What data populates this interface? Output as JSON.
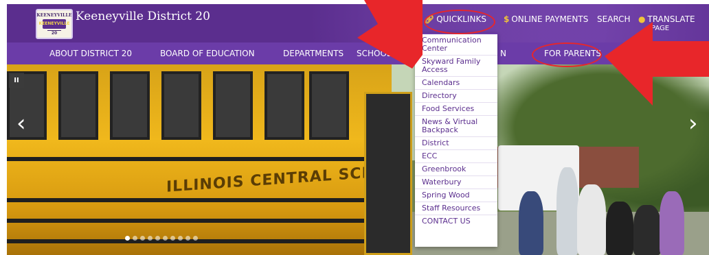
{
  "header": {
    "logo": {
      "top_text": "KEENEYVILLE",
      "badge_text": "KEENEYVILLE",
      "number": "20"
    },
    "site_title": "Keeneyville District 20",
    "utility_nav": {
      "quicklinks": "QUICKLINKS",
      "online_payments": "ONLINE PAYMENTS",
      "search": "SEARCH",
      "translate": "TRANSLATE",
      "translate_sub": "PAGE"
    }
  },
  "main_nav": {
    "items": [
      "ABOUT DISTRICT 20",
      "BOARD OF EDUCATION",
      "DEPARTMENTS",
      "SCHOOLS",
      "N",
      "FOR PARENTS"
    ]
  },
  "hero": {
    "bus_text": "ILLINOIS CENTRAL SCHOOL BUS",
    "pause_label": "II",
    "prev_label": "‹",
    "next_label": "›",
    "slide_count": 10,
    "active_slide": 1
  },
  "quicklinks_menu": {
    "items": [
      "Communication Center",
      "Skyward Family Access",
      "Calendars",
      "Directory",
      "Food Services",
      "News & Virtual Backpack",
      "District",
      "ECC",
      "Greenbrook",
      "Waterbury",
      "Spring Wood",
      "Staff Resources",
      "CONTACT US"
    ]
  },
  "icons": {
    "link": "link-icon",
    "dollar": "dollar-icon",
    "globe": "globe-icon"
  },
  "colors": {
    "header_purple": "#5b2e8e",
    "nav_purple": "#6b3ca8",
    "annotation_red": "#e8262a",
    "accent_gold": "#f0c43a"
  }
}
